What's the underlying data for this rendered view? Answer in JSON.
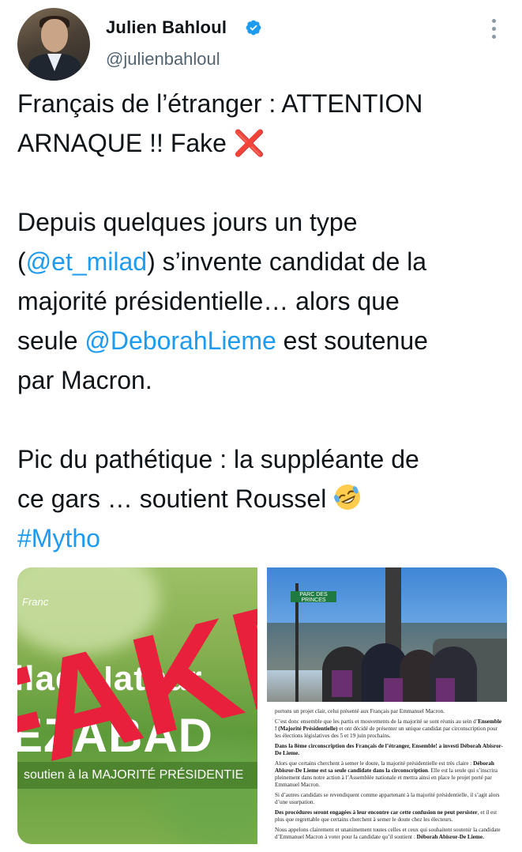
{
  "tweet": {
    "author_name": "Julien Bahloul",
    "author_handle": "@julienbahloul",
    "verified": true,
    "text": {
      "line1": "Français de l’étranger : ATTENTION",
      "line2_a": "ARNAQUE !! Fake ",
      "line2_mark": "❌",
      "line3": "Depuis quelques jours un type",
      "line4_open": "(",
      "line4_mention": "@et_milad",
      "line4_rest": ") s’invente candidat de la",
      "line5": "majorité présidentielle… alors que",
      "line6_a": "seule ",
      "line6_mention": "@DeborahLieme",
      "line6_rest": " est soutenue",
      "line7": "par Macron.",
      "line8": "Pic du pathétique : la suppléante de",
      "line9": "ce gars … soutient Roussel ",
      "line10_hashtag": "#Mytho"
    }
  },
  "colors": {
    "link": "#1d9bf0",
    "text": "#0f1419",
    "secondary": "#536471",
    "fake_mark": "#e0245e"
  },
  "icons": {
    "verified": "verified-badge-icon",
    "more": "more-options-icon",
    "emoji": "rolling-laughing-emoji-icon"
  },
  "media": {
    "left": {
      "small_text": "Franc",
      "name_text": "ilad Nathar",
      "big_text": "EZABAD",
      "band_text": "soutien à la MAJORITÉ PRÉSIDENTIE",
      "overlay_text": "FAKE"
    },
    "right_top": {
      "sign_text": "PARC DES PRINCES"
    },
    "right_bottom": {
      "p1": "portons un projet clair, celui présenté aux Français par Emmanuel Macron.",
      "p2_a": "C’est donc ensemble que les partis et mouvements de la majorité se sont réunis au sein d’",
      "p2_b": "Ensemble ! (Majorité Présidentielle)",
      "p2_c": " et ont décidé de présenter un unique candidat par circonscription pour les élections législatives des 5 et 19 juin prochains.",
      "p3": "Dans la 8ème circonscription des Français de l’étranger, Ensemble! a investi Déborah Abisror-De Lieme.",
      "p4_a": "Alors que certains cherchent à semer le doute, la majorité présidentielle est très claire : ",
      "p4_b": "Déborah Abisror-De Lieme est sa seule candidate dans la circonscription",
      "p4_c": ". Elle est la seule qui s’inscrira pleinement dans notre action à l’Assemblée nationale et mettra ainsi en place le projet porté par Emmanuel Macron.",
      "p5": "Si d’autres candidats se revendiquent comme appartenant à la majorité présidentielle, il s’agit alors d’une usurpation.",
      "p6_a": "Des procédures seront engagées à leur encontre car cette confusion ne peut persister",
      "p6_b": ", et il est plus que regrettable que certains cherchent à semer le doute chez les électeurs.",
      "p7_a": "Nous appelons clairement et unanimement toutes celles et ceux qui souhaitent soutenir la candidate d’Emmanuel Macron à voter pour la candidate qu’il soutient : ",
      "p7_b": "Déborah Abisror-De Lieme."
    }
  }
}
